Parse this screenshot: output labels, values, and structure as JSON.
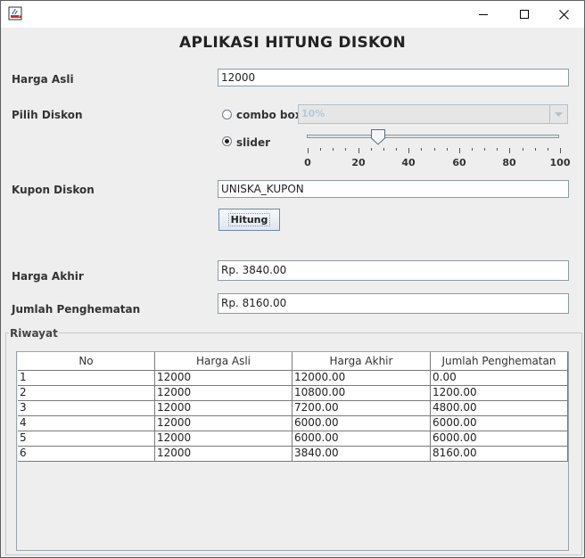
{
  "window": {
    "title": "",
    "icon": "java-cup-icon",
    "controls": [
      "minimize-icon",
      "maximize-icon",
      "close-icon"
    ]
  },
  "app": {
    "title": "APLIKASI HITUNG DISKON"
  },
  "form": {
    "harga_asli_label": "Harga Asli",
    "harga_asli_value": "12000",
    "pilih_diskon_label": "Pilih Diskon",
    "combo_option_label": "combo box",
    "combo_value": "10%",
    "combo_selected": false,
    "slider_option_label": "slider",
    "slider_selected": true,
    "slider": {
      "value": 28,
      "min": 0,
      "max": 100,
      "ticks": [
        "0",
        "20",
        "40",
        "60",
        "80",
        "100"
      ]
    },
    "kupon_label": "Kupon Diskon",
    "kupon_value": "UNISKA_KUPON",
    "hitung_button": "Hitung",
    "harga_akhir_label": "Harga Akhir",
    "harga_akhir_value": "Rp. 3840.00",
    "penghematan_label": "Jumlah Penghematan",
    "penghematan_value": "Rp. 8160.00"
  },
  "riwayat": {
    "title": "Riwayat",
    "columns": [
      "No",
      "Harga Asli",
      "Harga Akhir",
      "Jumlah Penghematan"
    ],
    "rows": [
      [
        "1",
        "12000",
        "12000.00",
        "0.00"
      ],
      [
        "2",
        "12000",
        "10800.00",
        "1200.00"
      ],
      [
        "3",
        "12000",
        "7200.00",
        "4800.00"
      ],
      [
        "4",
        "12000",
        "6000.00",
        "6000.00"
      ],
      [
        "5",
        "12000",
        "6000.00",
        "6000.00"
      ],
      [
        "6",
        "12000",
        "3840.00",
        "8160.00"
      ]
    ]
  },
  "colors": {
    "background": "#eeeeee",
    "field_border": "#8c9aa8",
    "disabled_text": "#b8c8dc"
  }
}
